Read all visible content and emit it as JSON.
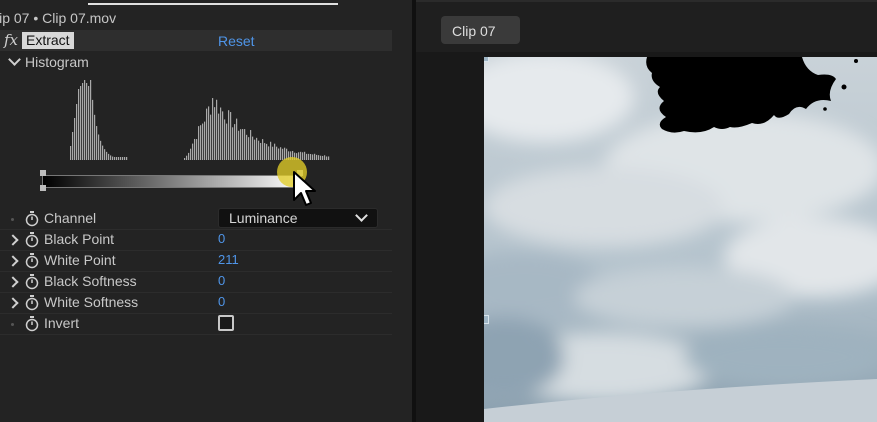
{
  "panel": {
    "clip_title": "lip 07 • Clip 07.mov",
    "fx_label": "fx",
    "effect_name": "Extract",
    "reset_label": "Reset",
    "histogram_label": "Histogram"
  },
  "properties": [
    {
      "label": "Channel",
      "value": "Luminance",
      "type": "dropdown"
    },
    {
      "label": "Black Point",
      "value": "0",
      "type": "number"
    },
    {
      "label": "White Point",
      "value": "211",
      "type": "number"
    },
    {
      "label": "Black Softness",
      "value": "0",
      "type": "number"
    },
    {
      "label": "White Softness",
      "value": "0",
      "type": "number"
    },
    {
      "label": "Invert",
      "value": "unchecked",
      "type": "checkbox"
    }
  ],
  "viewer": {
    "tab_label": "Clip 07"
  },
  "colors": {
    "accent_blue": "#4f95e8",
    "cursor_highlight": "#e1cd28"
  },
  "icons": [
    "fx-icon",
    "chevron-down-icon",
    "chevron-right-icon",
    "stopwatch-icon",
    "cursor-arrow-icon"
  ]
}
